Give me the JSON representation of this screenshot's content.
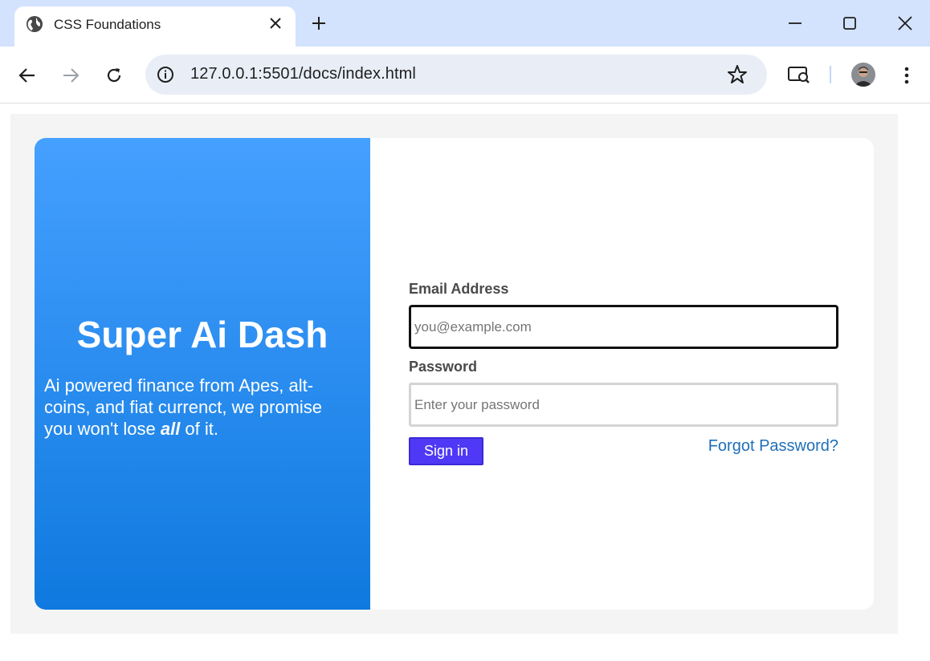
{
  "browser": {
    "tab_title": "CSS Foundations",
    "url": "127.0.0.1:5501/docs/index.html",
    "icons": [
      "globe-icon",
      "close-icon",
      "plus-icon",
      "minimize-icon",
      "maximize-icon",
      "window-close-icon",
      "back-arrow-icon",
      "forward-arrow-icon",
      "reload-icon",
      "info-icon",
      "star-icon",
      "lens-icon",
      "avatar",
      "kebab-menu-icon"
    ]
  },
  "hero": {
    "title": "Super Ai Dash",
    "text_before": "Ai powered finance from Apes, alt-coins, and fiat currenct, we promise you won't lose ",
    "text_emphasis": "all",
    "text_after": " of it."
  },
  "form": {
    "email_label": "Email Address",
    "email_placeholder": "you@example.com",
    "password_label": "Password",
    "password_placeholder": "Enter your password",
    "signin_label": "Sign in",
    "forgot_label": "Forgot Password?"
  },
  "colors": {
    "hero_gradient_top": "#45a0ff",
    "hero_gradient_bottom": "#0f79df",
    "signin_button": "#4f39f6",
    "link": "#1f6fb8",
    "page_background": "#f4f4f4",
    "tab_strip": "#d3e3fd"
  }
}
